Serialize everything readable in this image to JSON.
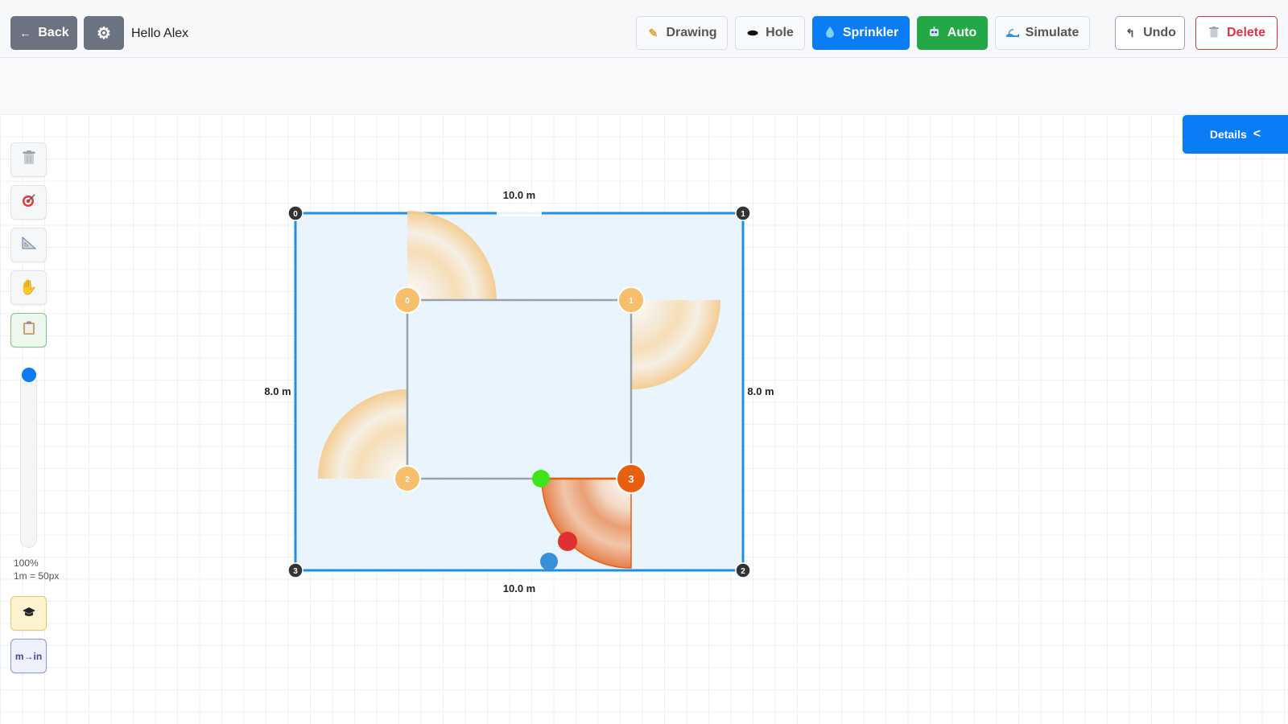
{
  "header": {
    "back_label": "Back",
    "greeting": "Hello Alex",
    "tools": {
      "drawing": "Drawing",
      "hole": "Hole",
      "sprinkler": "Sprinkler",
      "auto": "Auto",
      "simulate": "Simulate"
    },
    "undo_label": "Undo",
    "delete_label": "Delete"
  },
  "details_label": "Details",
  "sidebar": {
    "tools": [
      "trash-icon",
      "target-icon",
      "ruler-triangle-icon",
      "hand-icon",
      "clipboard-icon"
    ],
    "zoom_percent": "100%",
    "scale": "1m = 50px",
    "tutorial_icon": "graduation-cap-icon",
    "unit_toggle": "m→in"
  },
  "plan": {
    "outer_nodes": [
      "0",
      "1",
      "2",
      "3"
    ],
    "dimensions": {
      "top": "10.0 m",
      "bottom": "10.0 m",
      "left": "8.0 m",
      "right": "8.0 m"
    },
    "sprinklers": [
      {
        "label": "0",
        "selected": false
      },
      {
        "label": "1",
        "selected": false
      },
      {
        "label": "2",
        "selected": false
      },
      {
        "label": "3",
        "selected": true
      }
    ]
  },
  "colors": {
    "primary": "#0a7cf5",
    "success": "#22a846",
    "danger": "#dc3545",
    "lawn_fill": "#e6f2fb",
    "lawn_stroke": "#1d8fe6",
    "sprinkler": "#f7be6c",
    "sprinkler_selected": "#e8600f"
  }
}
